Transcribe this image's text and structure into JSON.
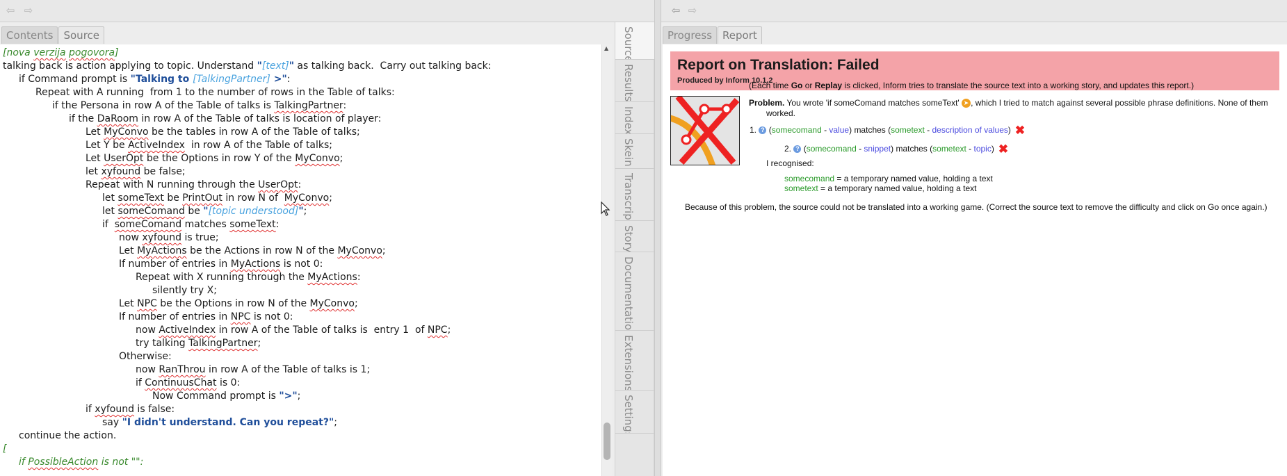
{
  "left_pane": {
    "tabs": [
      "Contents",
      "Source"
    ],
    "active_tab": "Source",
    "source_lines": [
      [
        {
          "t": "[nova ",
          "c": "cmt"
        },
        {
          "t": "verzija",
          "c": "cmt sp"
        },
        {
          "t": " ",
          "c": "cmt"
        },
        {
          "t": "pogovora",
          "c": "cmt sp"
        },
        {
          "t": "]",
          "c": "cmt"
        }
      ],
      [
        {
          "t": "talking back is action applying to topic. Understand "
        },
        {
          "t": "\"",
          "c": "str"
        },
        {
          "t": "[text]",
          "c": "sub"
        },
        {
          "t": "\"",
          "c": "str"
        },
        {
          "t": " as talking back.  Carry out talking back:"
        }
      ],
      [
        {
          "t": "if Command prompt is "
        },
        {
          "t": "\"Talking to ",
          "c": "str"
        },
        {
          "t": "[TalkingPartner]",
          "c": "sub"
        },
        {
          "t": " >\"",
          "c": "str"
        },
        {
          "t": ":"
        }
      ],
      [
        {
          "t": "Repeat with A running  from 1 to the number of rows in the Table of talks:"
        }
      ],
      [
        {
          "t": "if the Persona in row A of the Table of talks is "
        },
        {
          "t": "TalkingPartner",
          "c": "sp"
        },
        {
          "t": ":"
        }
      ],
      [
        {
          "t": "if the "
        },
        {
          "t": "DaRoom",
          "c": "sp"
        },
        {
          "t": " in row A of the Table of talks is location of player:"
        }
      ],
      [
        {
          "t": "Let "
        },
        {
          "t": "MyConvo",
          "c": "sp"
        },
        {
          "t": " be the tables in row A of the Table of talks;"
        }
      ],
      [
        {
          "t": "Let Y be "
        },
        {
          "t": "ActiveIndex",
          "c": "sp"
        },
        {
          "t": "  in row A of the Table of talks;"
        }
      ],
      [
        {
          "t": "Let "
        },
        {
          "t": "UserOpt",
          "c": "sp"
        },
        {
          "t": " be the Options in row Y of the "
        },
        {
          "t": "MyConvo",
          "c": "sp"
        },
        {
          "t": ";"
        }
      ],
      [
        {
          "t": "let "
        },
        {
          "t": "xyfound",
          "c": "sp"
        },
        {
          "t": " be false;"
        }
      ],
      [
        {
          "t": "Repeat with N running through the "
        },
        {
          "t": "UserOpt",
          "c": "sp"
        },
        {
          "t": ":"
        }
      ],
      [
        {
          "t": "let "
        },
        {
          "t": "someText",
          "c": "sp"
        },
        {
          "t": " be "
        },
        {
          "t": "PrintOut",
          "c": "sp"
        },
        {
          "t": " in row N of  "
        },
        {
          "t": "MyConvo",
          "c": "sp"
        },
        {
          "t": ";"
        }
      ],
      [
        {
          "t": "let "
        },
        {
          "t": "someComand",
          "c": "sp"
        },
        {
          "t": " be "
        },
        {
          "t": "\"",
          "c": "str"
        },
        {
          "t": "[topic understood]",
          "c": "sub"
        },
        {
          "t": "\"",
          "c": "str"
        },
        {
          "t": ";"
        }
      ],
      [
        {
          "t": "if  "
        },
        {
          "t": "someComand",
          "c": "sp"
        },
        {
          "t": " matches "
        },
        {
          "t": "someText",
          "c": "sp"
        },
        {
          "t": ":"
        }
      ],
      [
        {
          "t": "now "
        },
        {
          "t": "xyfound",
          "c": "sp"
        },
        {
          "t": " is true;"
        }
      ],
      [
        {
          "t": "Let "
        },
        {
          "t": "MyActions",
          "c": "sp"
        },
        {
          "t": " be the Actions in row N of the "
        },
        {
          "t": "MyConvo",
          "c": "sp"
        },
        {
          "t": ";"
        }
      ],
      [
        {
          "t": "If number of entries in "
        },
        {
          "t": "MyActions",
          "c": "sp"
        },
        {
          "t": " is not 0:"
        }
      ],
      [
        {
          "t": "Repeat with X running through the "
        },
        {
          "t": "MyActions",
          "c": "sp"
        },
        {
          "t": ":"
        }
      ],
      [
        {
          "t": "silently try X;"
        }
      ],
      [
        {
          "t": "Let "
        },
        {
          "t": "NPC",
          "c": "sp"
        },
        {
          "t": " be the Options in row N of the "
        },
        {
          "t": "MyConvo",
          "c": "sp"
        },
        {
          "t": ";"
        }
      ],
      [
        {
          "t": "If number of entries in "
        },
        {
          "t": "NPC",
          "c": "sp"
        },
        {
          "t": " is not 0:"
        }
      ],
      [
        {
          "t": "now "
        },
        {
          "t": "ActiveIndex",
          "c": "sp"
        },
        {
          "t": " in row A of the Table of talks is  entry 1  of "
        },
        {
          "t": "NPC",
          "c": "sp"
        },
        {
          "t": ";"
        }
      ],
      [
        {
          "t": "try talking "
        },
        {
          "t": "TalkingPartner",
          "c": "sp"
        },
        {
          "t": ";"
        }
      ],
      [
        {
          "t": "Otherwise:"
        }
      ],
      [
        {
          "t": "now "
        },
        {
          "t": "RanThrou",
          "c": "sp"
        },
        {
          "t": " in row A of the Table of talks is 1;"
        }
      ],
      [
        {
          "t": "if "
        },
        {
          "t": "ContinuusChat",
          "c": "sp"
        },
        {
          "t": " is 0:"
        }
      ],
      [
        {
          "t": "Now Command prompt is "
        },
        {
          "t": "\">\"",
          "c": "str"
        },
        {
          "t": ";"
        }
      ],
      [
        {
          "t": "if "
        },
        {
          "t": "xyfound",
          "c": "sp"
        },
        {
          "t": " is false:"
        }
      ],
      [
        {
          "t": "say "
        },
        {
          "t": "\"I didn't understand. Can you repeat?\"",
          "c": "str"
        },
        {
          "t": ";"
        }
      ],
      [
        {
          "t": "continue the action."
        }
      ],
      [
        {
          "t": "[",
          "c": "cmt"
        }
      ],
      [
        {
          "t": "if ",
          "c": "cmt"
        },
        {
          "t": "PossibleAction",
          "c": "cmt sp"
        },
        {
          "t": " is not \"\":",
          "c": "cmt"
        }
      ]
    ]
  },
  "side_tabs": [
    "Source",
    "Results",
    "Index",
    "Skein",
    "Transcript",
    "Story",
    "Documentation",
    "Extensions",
    "Settings"
  ],
  "right_pane": {
    "tabs": [
      "Progress",
      "Report"
    ],
    "active_tab": "Report",
    "report": {
      "title": "Report on Translation: Failed",
      "subtitle": "Produced by Inform 10.1.2",
      "intro": {
        "a": "(Each time ",
        "go": "Go",
        "b": " or ",
        "replay": "Replay",
        "c": " is clicked, Inform tries to translate the source text into a working story, and updates this report.)"
      },
      "problem_label": "Problem.",
      "problem_text_1": " You wrote 'if someComand matches someText' ",
      "problem_text_2": ", which I tried to match against several possible phrase definitions. None of them",
      "problem_text_3": "worked.",
      "item1": {
        "num": "1.",
        "p1": "(",
        "a": "somecomand",
        "dash1": " - ",
        "b": "value",
        "p2": ") matches (",
        "c": "sometext",
        "dash2": " - ",
        "d": "description of values",
        "p3": ")"
      },
      "item2": {
        "num": "2.",
        "p1": "(",
        "a": "somecomand",
        "dash1": " - ",
        "b": "snippet",
        "p2": ") matches (",
        "c": "sometext",
        "dash2": " - ",
        "d": "topic",
        "p3": ")"
      },
      "recognised": "I recognised:",
      "rec1_name": "somecomand",
      "rec1_rest": " = a temporary named value, holding a text",
      "rec2_name": "sometext",
      "rec2_rest": " = a temporary named value, holding a text",
      "conclusion": "Because of this problem, the source could not be translated into a working game. (Correct the source text to remove the difficulty and click on Go once again.)"
    }
  },
  "icons": {
    "back": "back-arrow-icon",
    "forward": "forward-arrow-icon",
    "cross": "red-cross-icon",
    "question": "question-icon"
  },
  "colors": {
    "report_header": "#f4a3a8",
    "string": "#1f4e9a",
    "substitution": "#4aa3df",
    "comment": "#3a8a2e"
  }
}
